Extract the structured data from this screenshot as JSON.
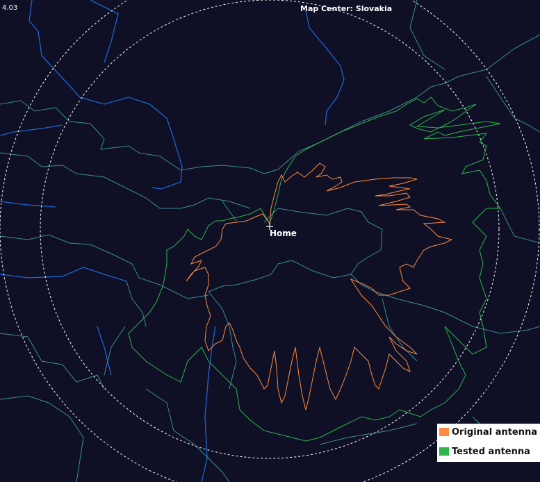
{
  "header": {
    "zoom_level": "4.03",
    "map_title": "Map Center: Slovakia"
  },
  "map": {
    "home_label": "Home",
    "background_color": "#0f1026",
    "range_ring_color": "#ffffff",
    "river_color": "#1e64d2",
    "border_color": "#3c8c96"
  },
  "legend": {
    "items": [
      {
        "label": "Original antenna",
        "color": "#ff8c3c"
      },
      {
        "label": "Tested antenna",
        "color": "#2db44a"
      }
    ]
  }
}
